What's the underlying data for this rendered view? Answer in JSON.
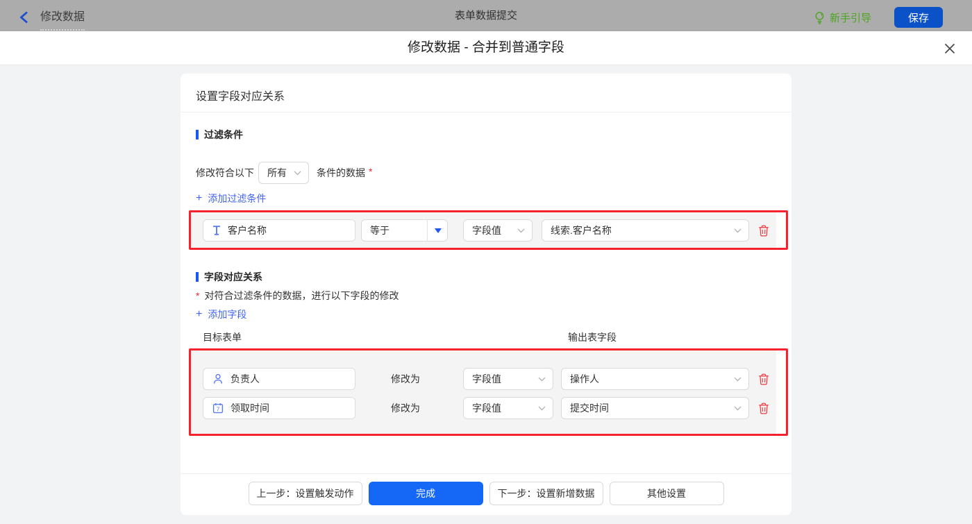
{
  "topbar": {
    "back_label": "修改数据",
    "center_title": "表单数据提交",
    "guide_label": "新手引导",
    "save_label": "保存"
  },
  "dialog": {
    "title": "修改数据 - 合并到普通字段",
    "close_icon": "x"
  },
  "card": {
    "header_title": "设置字段对应关系",
    "filter_section": {
      "title": "过滤条件",
      "match_prefix": "修改符合以下",
      "match_select_value": "所有",
      "match_suffix": "条件的数据",
      "required_mark": "*",
      "add_plus": "+",
      "add_label": "添加过滤条件",
      "rows": [
        {
          "field": "客户名称",
          "field_icon": "text-field-icon",
          "operator": "等于",
          "value_type": "字段值",
          "value": "线索.客户名称"
        }
      ]
    },
    "mapping_section": {
      "title": "字段对应关系",
      "required_mark": "*",
      "description": "对符合过滤条件的数据，进行以下字段的修改",
      "add_plus": "+",
      "add_label": "添加字段",
      "col_left": "目标表单",
      "col_right": "输出表字段",
      "modify_label": "修改为",
      "rows": [
        {
          "field": "负责人",
          "field_icon": "user-icon",
          "modify_label": "修改为",
          "value_type": "字段值",
          "value": "操作人"
        },
        {
          "field": "领取时间",
          "field_icon": "calendar-icon",
          "modify_label": "修改为",
          "value_type": "字段值",
          "value": "提交时间"
        }
      ]
    },
    "footer": {
      "prev_label": "上一步：设置触发动作",
      "done_label": "完成",
      "next_label": "下一步：设置新增数据",
      "other_label": "其他设置"
    }
  },
  "colors": {
    "topbar_bg": "#acacac",
    "accent_blue": "#1859f0",
    "link_blue": "#4365f3",
    "save_btn_blue": "#0b51c8",
    "done_btn_blue": "#1568f6",
    "guide_green": "#4da522",
    "highlight_red": "#f5222d",
    "field_icon_blue": "#5b7bf2",
    "body_bg": "#f2f3f5",
    "panel_gray": "#f4f4f5"
  }
}
